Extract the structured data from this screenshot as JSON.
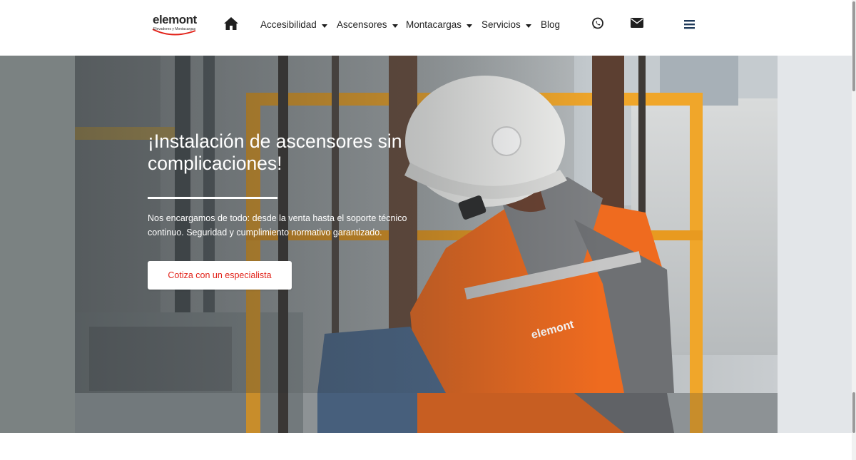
{
  "brand": {
    "name": "elemont",
    "tagline": "Elevadores y Montacargas",
    "accent_color": "#e2231a"
  },
  "nav": {
    "items": [
      {
        "label": "Accesibilidad",
        "has_dropdown": true
      },
      {
        "label": "Ascensores",
        "has_dropdown": true
      },
      {
        "label": "Montacargas",
        "has_dropdown": true
      },
      {
        "label": "Servicios",
        "has_dropdown": true
      },
      {
        "label": "Blog",
        "has_dropdown": false
      }
    ],
    "icons": [
      "home-icon",
      "whatsapp-icon",
      "envelope-icon",
      "hamburger-menu-icon"
    ]
  },
  "hero": {
    "title": "¡Instalación de ascensores sin complicaciones!",
    "description": "Nos encargamos de todo: desde la venta hasta el soporte técnico continuo. Seguridad y cumplimiento normativo garantizado.",
    "cta_label": "Cotiza con un especialista",
    "image_badge": "elemont"
  }
}
